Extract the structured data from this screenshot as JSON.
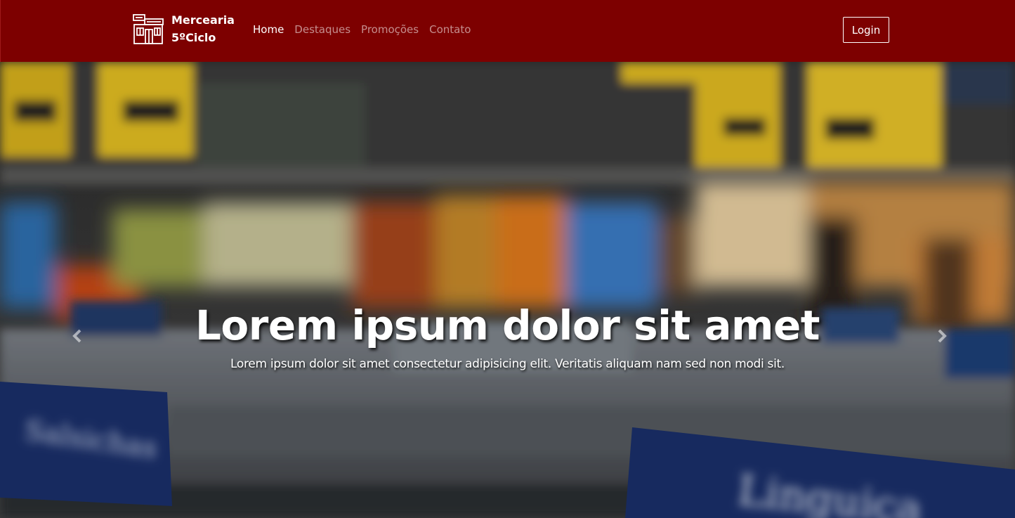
{
  "nav": {
    "brand_line1": "Mercearia",
    "brand_line2": "5ºCiclo",
    "brand_icon": "store-icon",
    "links": [
      {
        "label": "Home",
        "active": true
      },
      {
        "label": "Destaques",
        "active": false
      },
      {
        "label": "Promoções",
        "active": false
      },
      {
        "label": "Contato",
        "active": false
      }
    ],
    "login_label": "Login"
  },
  "hero": {
    "title": "Lorem ipsum dolor sit amet",
    "subtitle": "Lorem ipsum dolor sit amet consectetur adipisicing elit. Veritatis aliquam nam sed non modi sit.",
    "prev_icon": "chevron-left-icon",
    "next_icon": "chevron-right-icon",
    "sign_left": "Salsichas",
    "sign_right": "Linguiça"
  },
  "colors": {
    "navbar": "#7d0000",
    "text_light": "#ffffff"
  }
}
